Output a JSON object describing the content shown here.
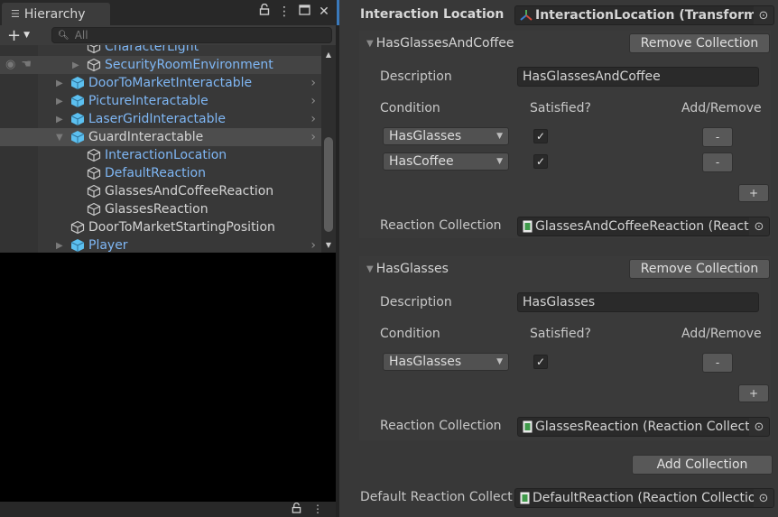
{
  "hierarchy": {
    "tab_title": "Hierarchy",
    "tab_icon": "list-icon",
    "search_placeholder": "All",
    "add_label": "+",
    "rows": [
      {
        "label": "CharacterLight",
        "kind": "plain-prefab",
        "indent": 2,
        "arrow": "",
        "partial": true
      },
      {
        "label": "SecurityRoomEnvironment",
        "kind": "prefab",
        "indent": 2,
        "arrow": "collapsed",
        "cube": "outline"
      },
      {
        "label": "DoorToMarketInteractable",
        "kind": "prefab",
        "indent": 1,
        "arrow": "collapsed",
        "cube": "filled"
      },
      {
        "label": "PictureInteractable",
        "kind": "prefab",
        "indent": 1,
        "arrow": "collapsed",
        "cube": "filled"
      },
      {
        "label": "LaserGridInteractable",
        "kind": "prefab",
        "indent": 1,
        "arrow": "collapsed",
        "cube": "filled"
      },
      {
        "label": "GuardInteractable",
        "kind": "plain",
        "indent": 1,
        "arrow": "expanded",
        "cube": "filled",
        "selected": true
      },
      {
        "label": "InteractionLocation",
        "kind": "prefab",
        "indent": 2,
        "arrow": "",
        "cube": "outline"
      },
      {
        "label": "DefaultReaction",
        "kind": "prefab",
        "indent": 2,
        "arrow": "",
        "cube": "outline"
      },
      {
        "label": "GlassesAndCoffeeReaction",
        "kind": "plain",
        "indent": 2,
        "arrow": "",
        "cube": "outline"
      },
      {
        "label": "GlassesReaction",
        "kind": "plain",
        "indent": 2,
        "arrow": "",
        "cube": "outline"
      },
      {
        "label": "DoorToMarketStartingPosition",
        "kind": "plain",
        "indent": 1,
        "arrow": "",
        "cube": "outline"
      },
      {
        "label": "Player",
        "kind": "prefab",
        "indent": 1,
        "arrow": "collapsed",
        "cube": "filled"
      }
    ]
  },
  "inspector": {
    "interaction_location": {
      "label": "Interaction Location",
      "value": "InteractionLocation (Transform)"
    },
    "collections": [
      {
        "title": "HasGlassesAndCoffee",
        "remove_label": "Remove Collection",
        "description_label": "Description",
        "description_value": "HasGlassesAndCoffee",
        "headers": {
          "condition": "Condition",
          "satisfied": "Satisfied?",
          "add_remove": "Add/Remove"
        },
        "conditions": [
          {
            "name": "HasGlasses",
            "satisfied": true,
            "remove_label": "-"
          },
          {
            "name": "HasCoffee",
            "satisfied": true,
            "remove_label": "-"
          }
        ],
        "add_label": "+",
        "reaction_label": "Reaction Collection",
        "reaction_value": "GlassesAndCoffeeReaction (Reaction Collection)"
      },
      {
        "title": "HasGlasses",
        "remove_label": "Remove Collection",
        "description_label": "Description",
        "description_value": "HasGlasses",
        "headers": {
          "condition": "Condition",
          "satisfied": "Satisfied?",
          "add_remove": "Add/Remove"
        },
        "conditions": [
          {
            "name": "HasGlasses",
            "satisfied": true,
            "remove_label": "-"
          }
        ],
        "add_label": "+",
        "reaction_label": "Reaction Collection",
        "reaction_value": "GlassesReaction (Reaction Collection)"
      }
    ],
    "add_collection_label": "Add Collection",
    "default_reaction": {
      "label": "Default Reaction Collection",
      "value": "DefaultReaction (Reaction Collection)"
    },
    "checkmark": "✓"
  },
  "colors": {
    "prefab_text": "#7fb7f5",
    "prefab_cube": "#5cc0f0",
    "accent": "#3a79bb",
    "script_icon": "#3f9a4a"
  }
}
